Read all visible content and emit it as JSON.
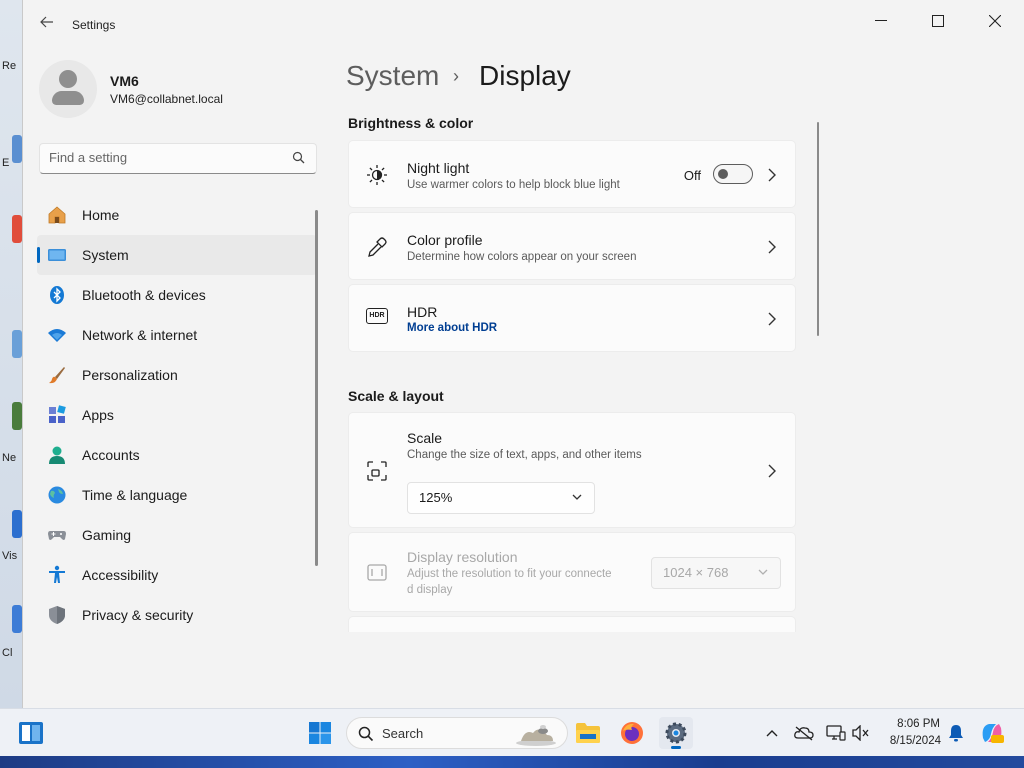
{
  "desktop": {
    "labels": [
      "Re",
      "E",
      "Ne",
      "Vis",
      "Cl"
    ]
  },
  "window": {
    "app_title": "Settings"
  },
  "profile": {
    "name": "VM6",
    "email": "VM6@collabnet.local"
  },
  "search": {
    "placeholder": "Find a setting"
  },
  "nav": {
    "items": [
      {
        "label": "Home",
        "icon": "home-icon",
        "selected": false
      },
      {
        "label": "System",
        "icon": "system-icon",
        "selected": true
      },
      {
        "label": "Bluetooth & devices",
        "icon": "bluetooth-icon",
        "selected": false
      },
      {
        "label": "Network & internet",
        "icon": "wifi-icon",
        "selected": false
      },
      {
        "label": "Personalization",
        "icon": "brush-icon",
        "selected": false
      },
      {
        "label": "Apps",
        "icon": "apps-icon",
        "selected": false
      },
      {
        "label": "Accounts",
        "icon": "accounts-icon",
        "selected": false
      },
      {
        "label": "Time & language",
        "icon": "globe-icon",
        "selected": false
      },
      {
        "label": "Gaming",
        "icon": "gamepad-icon",
        "selected": false
      },
      {
        "label": "Accessibility",
        "icon": "accessibility-icon",
        "selected": false
      },
      {
        "label": "Privacy & security",
        "icon": "shield-icon",
        "selected": false
      }
    ]
  },
  "breadcrumb": {
    "parent": "System",
    "separator": "›",
    "current": "Display"
  },
  "sections": {
    "brightness": "Brightness & color",
    "scale_layout": "Scale & layout"
  },
  "night_light": {
    "title": "Night light",
    "subtitle": "Use warmer colors to help block blue light",
    "toggle_state": "Off"
  },
  "color_profile": {
    "title": "Color profile",
    "subtitle": "Determine how colors appear on your screen"
  },
  "hdr": {
    "title": "HDR",
    "link": "More about HDR",
    "icon_text": "HDR"
  },
  "scale": {
    "title": "Scale",
    "subtitle": "Change the size of text, apps, and other items",
    "value": "125%"
  },
  "resolution": {
    "title": "Display resolution",
    "subtitle_line1": "Adjust the resolution to fit your connecte",
    "subtitle_line2": "d display",
    "value": "1024 × 768"
  },
  "taskbar": {
    "search_label": "Search",
    "time": "8:06 PM",
    "date": "8/15/2024"
  },
  "colors": {
    "accent": "#0067c0",
    "link": "#003e92",
    "window_bg": "#f3f3f3",
    "card_bg": "#fbfbfb"
  }
}
